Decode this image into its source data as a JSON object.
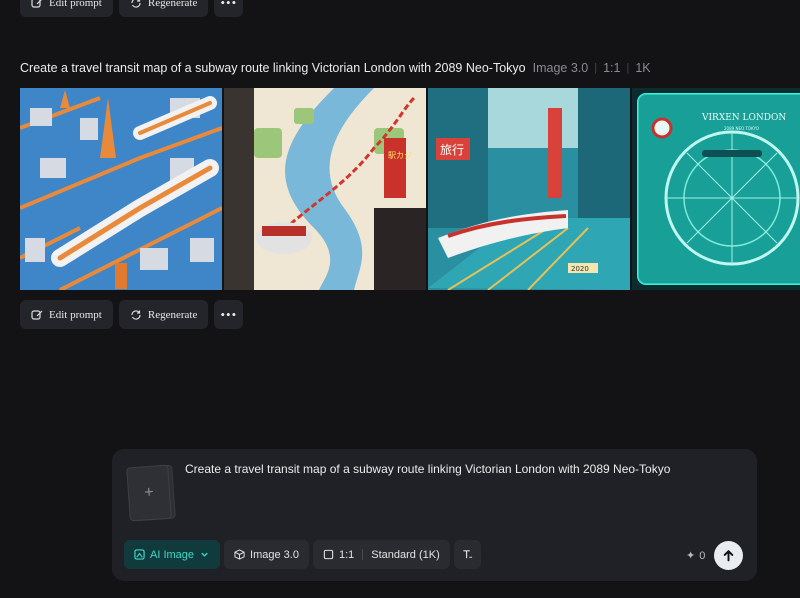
{
  "actions": {
    "edit_label": "Edit prompt",
    "regenerate_label": "Regenerate",
    "more_label": "•••"
  },
  "generation": {
    "prompt": "Create a travel transit map of a subway route linking Victorian London with 2089 Neo-Tokyo",
    "model": "Image 3.0",
    "ratio": "1:1",
    "resolution": "1K"
  },
  "images": [
    {
      "name": "isometric-train-city"
    },
    {
      "name": "river-map-train"
    },
    {
      "name": "teal-street-train"
    },
    {
      "name": "cyan-circular-map",
      "text_1": "VIRXEN LONDON",
      "text_2": "2089 NEO TOKYO"
    }
  ],
  "tile_texts": {
    "tile3_sign": "旅行",
    "tile3_badge": "2020",
    "tile2_sign": "駅カジ"
  },
  "composer": {
    "prompt_text": "Create a travel transit map of a subway route linking Victorian London with 2089 Neo-Tokyo",
    "add_icon": "+",
    "ai_image_label": "AI Image",
    "model_label": "Image 3.0",
    "ratio_label": "1:1",
    "quality_label": "Standard (1K)",
    "credits": "0",
    "credits_icon": "sparkle-icon",
    "send_icon": "arrow-up-icon"
  },
  "colors": {
    "accent": "#3fd7c9",
    "background": "#131316",
    "panel": "#202126"
  }
}
